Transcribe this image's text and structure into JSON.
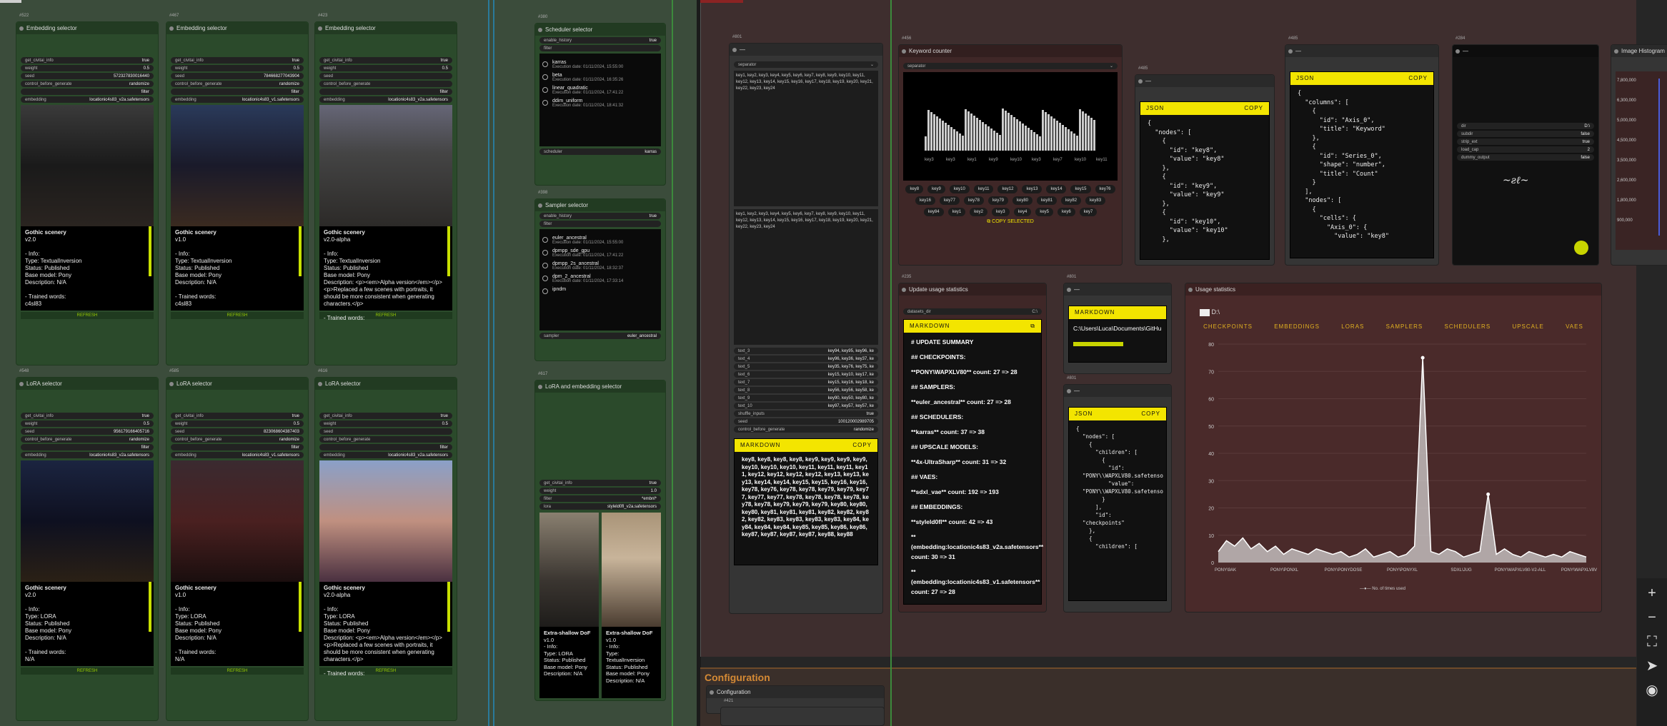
{
  "colors": {
    "accent_yellow": "#f3e500",
    "group_green": "#3b4c3b",
    "group_red": "#3e2e2e",
    "link_blue": "#55ccff",
    "link_green": "#6f6"
  },
  "embedding_nodes": [
    {
      "id": "#522",
      "title": "Embedding selector",
      "get_civitai": "true",
      "weight": "0.5",
      "seed": "572327830016440",
      "control": "randomize",
      "filter": "filter",
      "value": "locationic4s83_v2a.safetensors",
      "name": "Gothic scenery",
      "ver": "v2.0",
      "type": "TextualInversion",
      "status": "Published",
      "base": "Pony",
      "desc": "N/A",
      "words": "c4sl83"
    },
    {
      "id": "#467",
      "title": "Embedding selector",
      "get_civitai": "true",
      "weight": "0.5",
      "seed": "784668277043904",
      "control": "randomize",
      "filter": "filter",
      "value": "locationic4s83_v1.safetensors",
      "name": "Gothic scenery",
      "ver": "v1.0",
      "type": "TextualInversion",
      "status": "Published",
      "base": "Pony",
      "desc": "N/A",
      "words": "c4sl83"
    },
    {
      "id": "#423",
      "title": "Embedding selector",
      "get_civitai": "true",
      "weight": "0.5",
      "seed": "",
      "control": "",
      "filter": "filter",
      "value": "locationic4s83_v2a.safetensors",
      "name": "Gothic scenery",
      "ver": "v2.0-alpha",
      "type": "TextualInversion",
      "status": "Published",
      "base": "Pony",
      "desc": "<p><em>Alpha version</em></p><p>Replaced a few scenes with portraits, it should be more consistent when generating characters.</p>",
      "words": ""
    }
  ],
  "lora_nodes": [
    {
      "id": "#548",
      "title": "LoRA selector",
      "get_civitai": "true",
      "weight": "0.5",
      "seed": "956179166405716",
      "control": "randomize",
      "filter": "filter",
      "value": "locationic4s83_v2a.safetensors",
      "name": "Gothic scenery",
      "ver": "v2.0",
      "type": "LORA",
      "status": "Published",
      "base": "Pony",
      "desc": "N/A",
      "words": "N/A"
    },
    {
      "id": "#585",
      "title": "LoRA selector",
      "get_civitai": "true",
      "weight": "0.5",
      "seed": "823068604387403",
      "control": "randomize",
      "filter": "filter",
      "value": "locationic4s83_v1.safetensors",
      "name": "Gothic scenery",
      "ver": "v1.0",
      "type": "LORA",
      "status": "Published",
      "base": "Pony",
      "desc": "N/A",
      "words": "N/A"
    },
    {
      "id": "#616",
      "title": "LoRA selector",
      "get_civitai": "true",
      "weight": "0.5",
      "seed": "",
      "control": "",
      "filter": "filter",
      "value": "locationic4s83_v2a.safetensors",
      "name": "Gothic scenery",
      "ver": "v2.0-alpha",
      "type": "LORA",
      "status": "Published",
      "base": "Pony",
      "desc": "<p><em>Alpha version</em></p><p>Replaced a few scenes with portraits, it should be more consistent when generating characters.</p>",
      "words": ""
    }
  ],
  "refresh_label": "REFRESH",
  "scheduler": {
    "id": "#380",
    "title": "Scheduler selector",
    "enable_history": "true",
    "filter": "filter",
    "items": [
      {
        "n": "karras",
        "d": "Execution date: 01/11/2024, 15:55:00"
      },
      {
        "n": "beta",
        "d": "Execution date: 01/11/2024, 16:35:26"
      },
      {
        "n": "linear_quadratic",
        "d": "Execution date: 01/11/2024, 17:41:22"
      },
      {
        "n": "ddim_uniform",
        "d": "Execution date: 01/11/2024, 18:41:32"
      }
    ],
    "value": "karras"
  },
  "sampler": {
    "id": "#398",
    "title": "Sampler selector",
    "enable_history": "true",
    "filter": "filter",
    "items": [
      {
        "n": "euler_ancestral",
        "d": "Execution date: 01/11/2024, 15:55:00"
      },
      {
        "n": "dpmpp_sde_gpu",
        "d": "Execution date: 01/11/2024, 17:41:22"
      },
      {
        "n": "dpmpp_2s_ancestral",
        "d": "Execution date: 01/11/2024, 18:32:37"
      },
      {
        "n": "dpm_2_ancestral",
        "d": "Execution date: 01/11/2024, 17:33:14"
      },
      {
        "n": "ipndm",
        "d": ""
      }
    ],
    "value": "euler_ancestral"
  },
  "lora_embed": {
    "id": "#617",
    "title": "LoRA and embedding selector",
    "get_civitai": "true",
    "weight": "1.0",
    "filter": "*embnl*",
    "value": "styleld0fl_v2a.safetensors",
    "cards": [
      {
        "name": "Extra-shallow DoF",
        "ver": "v1.0",
        "type": "LORA",
        "status": "Published",
        "base": "Pony",
        "desc": "N/A"
      },
      {
        "name": "Extra-shallow DoF",
        "ver": "v1.0",
        "type": "TextualInversion",
        "status": "Published",
        "base": "Pony",
        "desc": "N/A"
      }
    ]
  },
  "left_column": {
    "separator": "separator",
    "keys_top": "key1, key2, key3, key4, key5, key6, key7, key8, key9, key10, key11, key12, key13, key14, key15, key16, key17, key18, key19, key20, key21, key22, key23, key24",
    "rows": [
      "text_3",
      "text_4",
      "text_5",
      "text_6",
      "text_7",
      "text_8",
      "text_9",
      "text_10"
    ],
    "vals": [
      "key94, key95, key96, ke",
      "key96, key36, key37, ke",
      "key35, key76, key75, ke",
      "key15, key10, key17, ke",
      "key15, key16, key18, ke",
      "key56, key56, key58, ke",
      "key90, key50, key80, ke",
      "key97, key57, key57, ke"
    ],
    "shuffle": "shuffle_inputs",
    "shuffle_v": "true",
    "seed": "seed",
    "seed_v": "100120002989705",
    "control": "control_before_generate",
    "control_v": "randomize",
    "md_title": "MARKDOWN",
    "md_keys": "key8, key8, key8, key8, key9, key9, key9, key9, key10, key10, key10, key11, key11, key11, key11, key12, key12, key12, key12, key13, key13, key13, key14, key14, key15, key15, key16, key16, key78, key76, key78, key78, key79, key79, key77, key77, key77, key78, key78, key78, key78, key78, key78, key79, key79, key79, key80, key80, key80, key81, key81, key81, key82, key82, key82, key82, key83, key83, key83, key83, key84, key84, key84, key84, key85, key85, key86, key86, key87, key87, key87, key87, key88, key88"
  },
  "keyword_counter": {
    "id": "#456",
    "title": "Keyword counter",
    "separator": "separator",
    "tick_labels": [
      "key3",
      "key3",
      "key1",
      "key9",
      "key10",
      "key3",
      "key7",
      "key10",
      "key11"
    ],
    "chips": [
      "key8",
      "key9",
      "key10",
      "key11",
      "key12",
      "key13",
      "key14",
      "key15",
      "key76",
      "key16",
      "key77",
      "key78",
      "key79",
      "key80",
      "key81",
      "key82",
      "key83",
      "key84",
      "key1",
      "key2",
      "key3",
      "key4",
      "key5",
      "key6",
      "key7"
    ],
    "button": "COPY SELECTED"
  },
  "json_panels": {
    "label": "JSON",
    "copy": "COPY"
  },
  "json_a": "{\n  \"nodes\": [\n    {\n      \"id\": \"key8\",\n      \"value\": \"key8\"\n    },\n    {\n      \"id\": \"key9\",\n      \"value\": \"key9\"\n    },\n    {\n      \"id\": \"key10\",\n      \"value\": \"key10\"\n    },",
  "json_b": "{\n  \"columns\": [\n    {\n      \"id\": \"Axis_0\",\n      \"title\": \"Keyword\"\n    },\n    {\n      \"id\": \"Series_0\",\n      \"shape\": \"number\",\n      \"title\": \"Count\"\n    }\n  ],\n  \"nodes\": [\n    {\n      \"cells\": {\n        \"Axis_0\": {\n          \"value\": \"key8\"",
  "json_c": "{\n  \"nodes\": [\n    {\n      \"children\": [\n        {\n          \"id\":\n  \"PONY\\\\WAPXLV80.safetenso\n          \"value\":\n  \"PONY\\\\WAPXLV80.safetenso\n        }\n      ],\n      \"id\":\n  \"checkpoints\"\n    },\n    {\n      \"children\": [",
  "image_node": {
    "widgets": [
      {
        "k": "dir",
        "v": "D:\\"
      },
      {
        "k": "subdir",
        "v": "false"
      },
      {
        "k": "strip_ext",
        "v": "true"
      },
      {
        "k": "load_cap",
        "v": "2"
      },
      {
        "k": "dummy_output",
        "v": "false"
      }
    ]
  },
  "image_histogram": {
    "title": "Image Histogram"
  },
  "update_usage": {
    "id": "#235",
    "title": "Update usage statistics",
    "datasets": "datasets_dir",
    "md_title": "MARKDOWN",
    "lines": [
      "# UPDATE SUMMARY",
      "## CHECKPOINTS:",
      "**PONY\\WAPXLV80** count: 27 => 28",
      "## SAMPLERS:",
      "**euler_ancestral** count: 27 => 28",
      "## SCHEDULERS:",
      "**karras** count: 37 => 38",
      "## UPSCALE MODELS:",
      "**4x-UltraSharp** count: 31 => 32",
      "## VAES:",
      "**sdxl_vae** count: 192 => 193",
      "## EMBEDDINGS:",
      "**styleld0fl** count: 42 => 43",
      "**(embedding:locationic4s83_v2a.safetensors** count: 30 => 31",
      "**(embedding:locationic4s83_v1.safetensors** count: 27 => 28"
    ]
  },
  "path_md": {
    "title": "MARKDOWN",
    "text": "C:\\Users\\Luca\\Documents\\GitHu"
  },
  "usage": {
    "title": "Usage statistics",
    "folder": "D:\\",
    "tabs": [
      "CHECKPOINTS",
      "EMBEDDINGS",
      "LORAS",
      "SAMPLERS",
      "SCHEDULERS",
      "UPSCALE",
      "VAES"
    ],
    "legend": "No. of times used"
  },
  "chart_data": {
    "type": "area",
    "series": [
      {
        "name": "No. of times used",
        "values": [
          4,
          8,
          6,
          9,
          5,
          7,
          4,
          6,
          3,
          5,
          4,
          3,
          5,
          4,
          3,
          4,
          2,
          3,
          5,
          2,
          3,
          4,
          2,
          3,
          6,
          75,
          4,
          3,
          5,
          4,
          2,
          3,
          4,
          25,
          3,
          5,
          3,
          2,
          4,
          3,
          2,
          3,
          2,
          4,
          3,
          2
        ]
      }
    ],
    "ylim": [
      0,
      80
    ],
    "xtick_labels": [
      "PONY\\9AK",
      "PONY\\PONXL",
      "PONY\\PONYDOSE",
      "PONY\\PONYXL",
      "SDXL\\JUG",
      "PONY\\WAPXLV80-V2-ALL",
      "PONY\\WAPXLV8V"
    ],
    "yticks": [
      0,
      10,
      20,
      30,
      40,
      50,
      60,
      70,
      80
    ]
  },
  "histogram_axis": [
    "7,800,000",
    "6,300,000",
    "5,000,000",
    "4,500,000",
    "3,500,000",
    "2,600,000",
    "1,800,000",
    "900,000"
  ],
  "config": {
    "title": "Configuration",
    "sub": "Configuration",
    "id": "#421"
  },
  "toolbar": {
    "plus": "+",
    "minus": "−",
    "fit": "⛶",
    "nav": "➤",
    "eye": "◉"
  }
}
